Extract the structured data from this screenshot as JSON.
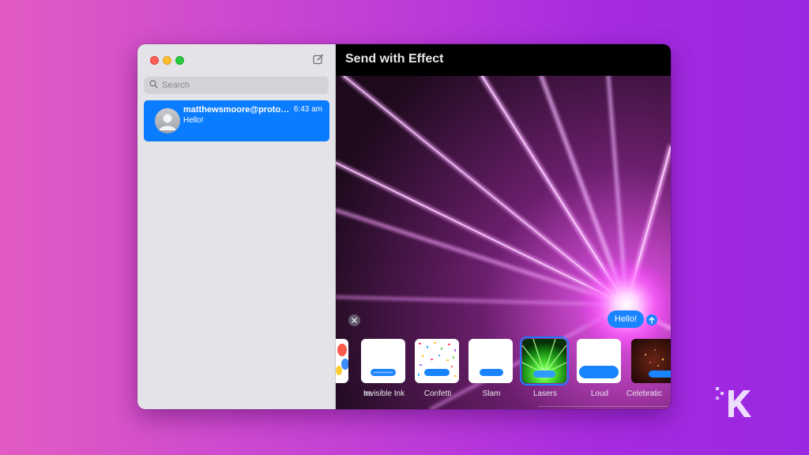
{
  "window": {
    "sidebar": {
      "search": {
        "placeholder": "Search",
        "value": ""
      },
      "conversations": [
        {
          "name": "matthewsmoore@proton...",
          "time": "6:43 am",
          "preview": "Hello!"
        }
      ]
    },
    "effect_pane": {
      "title": "Send with Effect",
      "message": "Hello!",
      "effects": [
        {
          "label": "Balloons",
          "visible_label": "ns",
          "icon": "balloons-thumbnail"
        },
        {
          "label": "Invisible Ink",
          "icon": "invisible-ink-thumbnail"
        },
        {
          "label": "Confetti",
          "icon": "confetti-thumbnail"
        },
        {
          "label": "Slam",
          "icon": "slam-thumbnail"
        },
        {
          "label": "Lasers",
          "icon": "lasers-thumbnail",
          "selected": true
        },
        {
          "label": "Loud",
          "icon": "loud-thumbnail"
        },
        {
          "label": "Celebration",
          "visible_label": "Celebratic",
          "icon": "celebration-thumbnail"
        }
      ]
    }
  },
  "colors": {
    "accent": "#0a7cff",
    "laser": "#ff5cff",
    "background_left": "#e25bc3",
    "background_right": "#9a27e2"
  },
  "icons": [
    "compose-icon",
    "search-icon",
    "close-icon",
    "send-arrow-icon",
    "avatar-icon",
    "brand-k-logo"
  ]
}
